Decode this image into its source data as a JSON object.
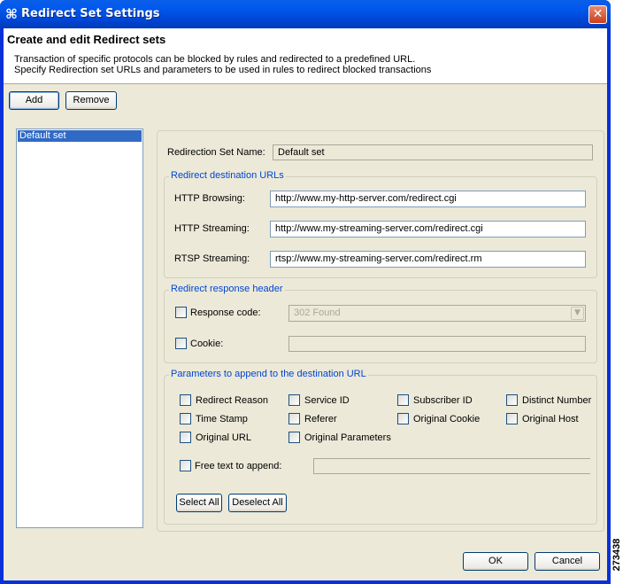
{
  "window": {
    "title": "Redirect Set Settings",
    "app_icon": "cisco-icon",
    "close_icon": "close-icon"
  },
  "header": {
    "title": "Create and edit Redirect sets",
    "desc1": "Transaction of specific protocols can be blocked by rules and redirected to a predefined URL.",
    "desc2": "Specify Redirection set URLs and parameters to be used in rules to redirect blocked transactions"
  },
  "toolbar": {
    "add": "Add",
    "remove": "Remove"
  },
  "sets": [
    "Default set"
  ],
  "form": {
    "name_label": "Redirection Set Name:",
    "name_value": "Default set",
    "dest_group": "Redirect destination URLs",
    "dest": [
      {
        "label": "HTTP Browsing:",
        "value": "http://www.my-http-server.com/redirect.cgi"
      },
      {
        "label": "HTTP Streaming:",
        "value": "http://www.my-streaming-server.com/redirect.cgi"
      },
      {
        "label": "RTSP Streaming:",
        "value": "rtsp://www.my-streaming-server.com/redirect.rm"
      }
    ],
    "resp_group": "Redirect response header",
    "response_code_label": "Response code:",
    "response_code_value": "302 Found",
    "response_code_checked": false,
    "cookie_label": "Cookie:",
    "cookie_value": "",
    "cookie_checked": false,
    "params_group": "Parameters to append to the destination URL",
    "params": [
      {
        "label": "Redirect Reason",
        "checked": false
      },
      {
        "label": "Service ID",
        "checked": false
      },
      {
        "label": "Subscriber ID",
        "checked": false
      },
      {
        "label": "Distinct Number",
        "checked": false
      },
      {
        "label": "Time Stamp",
        "checked": false
      },
      {
        "label": "Referer",
        "checked": false
      },
      {
        "label": "Original Cookie",
        "checked": false
      },
      {
        "label": "Original Host",
        "checked": false
      },
      {
        "label": "Original URL",
        "checked": false
      },
      {
        "label": "Original Parameters",
        "checked": false
      }
    ],
    "free_text_label": "Free text to append:",
    "free_text_value": "",
    "free_text_checked": false,
    "select_all": "Select All",
    "deselect_all": "Deselect All"
  },
  "footer": {
    "ok": "OK",
    "cancel": "Cancel"
  },
  "figure_id": "273438"
}
